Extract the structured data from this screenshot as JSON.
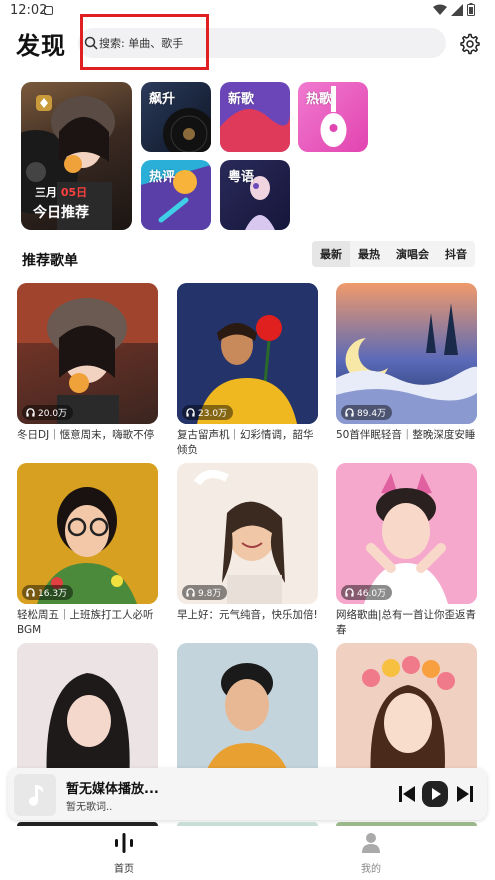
{
  "status_bar": {
    "time": "12:02"
  },
  "header": {
    "title": "发现",
    "search_placeholder": "搜索: 单曲、歌手"
  },
  "quick_tiles": {
    "large": {
      "date_month": "三月",
      "date_day": "05日",
      "label": "今日推荐"
    },
    "small": [
      {
        "label": "飙升"
      },
      {
        "label": "新歌"
      },
      {
        "label": "热歌"
      },
      {
        "label": "热评"
      },
      {
        "label": "粤语"
      }
    ]
  },
  "playlists": {
    "section_title": "推荐歌单",
    "tabs": [
      "最新",
      "最热",
      "演唱会",
      "抖音"
    ],
    "items": [
      {
        "plays": "20.0万",
        "title": "冬日DJ｜惬意周末，嗨歌不停"
      },
      {
        "plays": "23.0万",
        "title": "复古留声机｜幻彩情调，韶华倾负"
      },
      {
        "plays": "89.4万",
        "title": "50首伴眠轻音｜整晚深度安睡"
      },
      {
        "plays": "16.3万",
        "title": "轻松周五｜上班族打工人必听BGM"
      },
      {
        "plays": "9.8万",
        "title": "早上好：元气纯音，快乐加倍!"
      },
      {
        "plays": "46.0万",
        "title": "网络歌曲|总有一首让你歪返青春"
      },
      {
        "plays": "",
        "title": ""
      },
      {
        "plays": "",
        "title": ""
      },
      {
        "plays": "",
        "title": ""
      }
    ]
  },
  "mini_player": {
    "title": "暂无媒体播放...",
    "lyric": "暂无歌词.."
  },
  "bottom_nav": [
    {
      "label": "首页",
      "icon": "waveform-icon",
      "active": true
    },
    {
      "label": "我的",
      "icon": "person-icon",
      "active": false
    }
  ],
  "colors": {
    "highlight": "#e02020",
    "accent_red": "#ff4040"
  }
}
